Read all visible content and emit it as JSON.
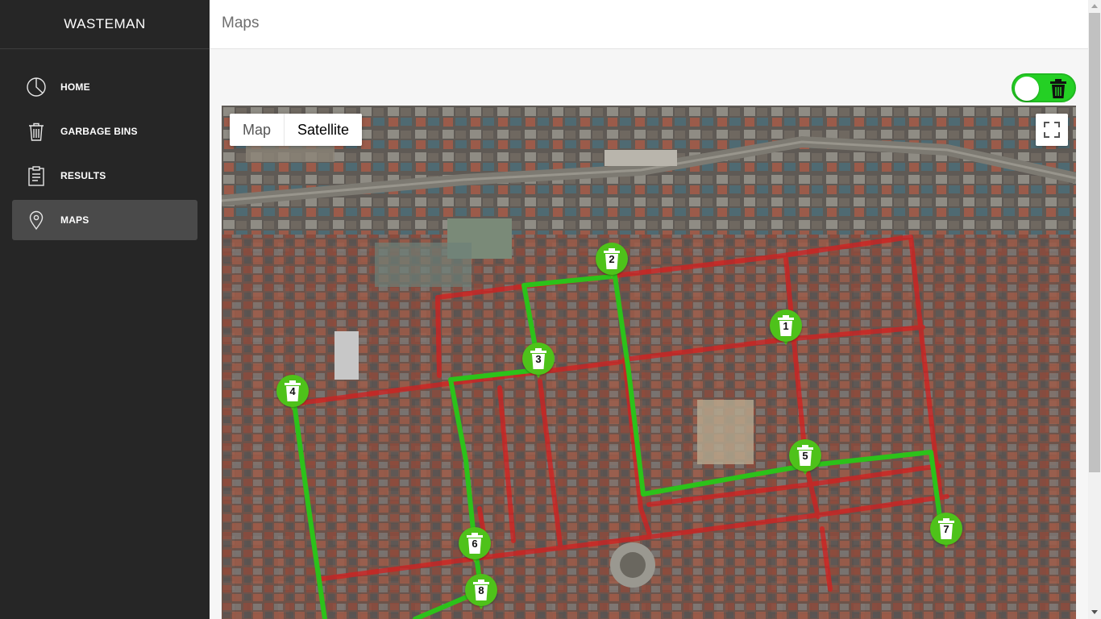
{
  "app": {
    "brand": "WASTEMAN"
  },
  "header": {
    "title": "Maps"
  },
  "sidebar": {
    "items": [
      {
        "label": "HOME",
        "icon": "pie-chart-icon",
        "active": false
      },
      {
        "label": "GARBAGE BINS",
        "icon": "trash-bin-icon",
        "active": false
      },
      {
        "label": "RESULTS",
        "icon": "clipboard-icon",
        "active": false
      },
      {
        "label": "MAPS",
        "icon": "map-pin-icon",
        "active": true
      }
    ]
  },
  "toggle": {
    "on": true,
    "icon": "trash-bin-icon",
    "color": "#24d024"
  },
  "map": {
    "type_control": {
      "map_label": "Map",
      "satellite_label": "Satellite",
      "selected": "Satellite"
    },
    "fullscreen_icon": "fullscreen-icon",
    "route_color": "#2cc21a",
    "street_highlight_color": "#d41f1f",
    "markers": [
      {
        "label": "1"
      },
      {
        "label": "2"
      },
      {
        "label": "3"
      },
      {
        "label": "4"
      },
      {
        "label": "5"
      },
      {
        "label": "6"
      },
      {
        "label": "7"
      },
      {
        "label": "8"
      }
    ]
  }
}
